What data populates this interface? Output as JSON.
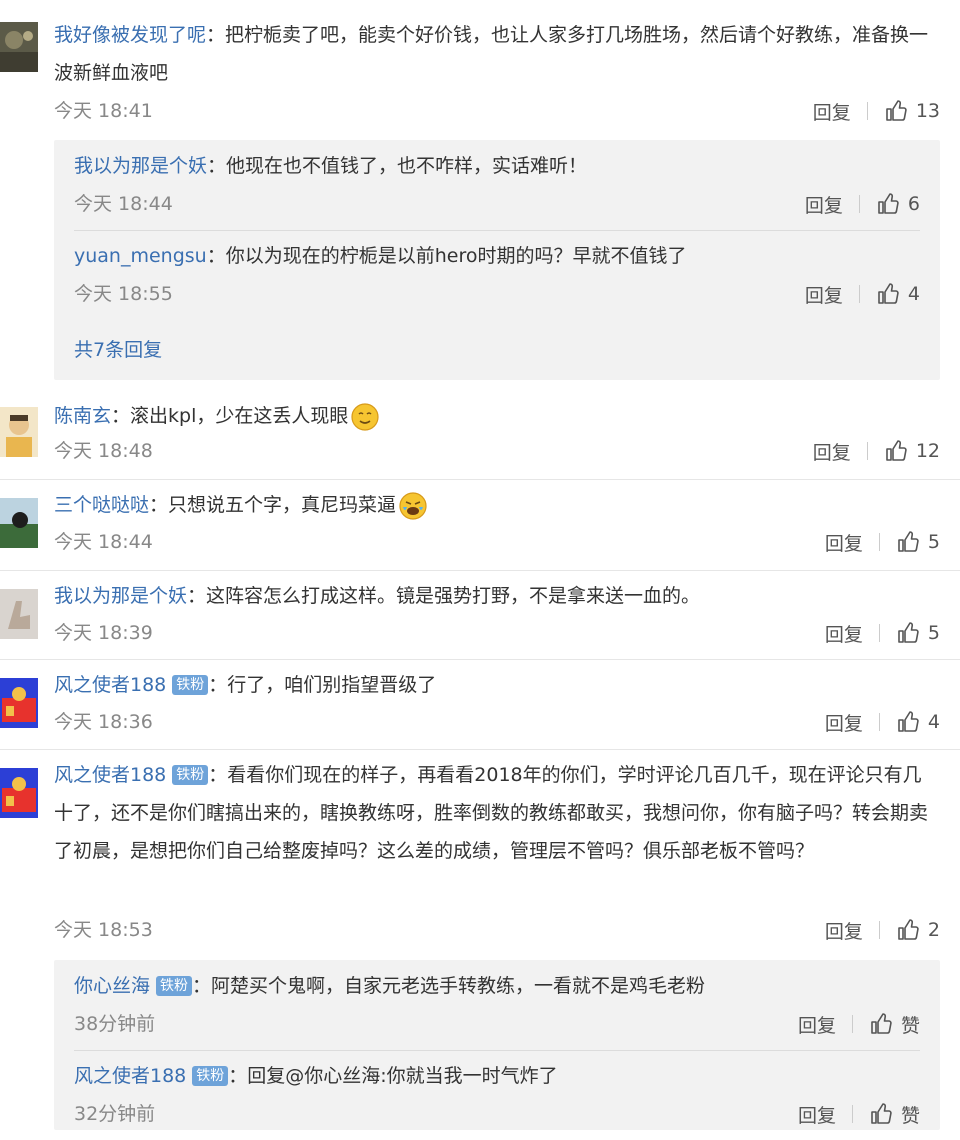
{
  "comments": [
    {
      "user": "我好像被发现了呢",
      "text": "把柠栀卖了吧，能卖个好价钱，也让人家多打几场胜场，然后请个好教练，准备换一波新鲜血液吧",
      "time": "今天 18:41",
      "reply_label": "回复",
      "likes": "13",
      "replies": [
        {
          "user": "我以为那是个妖",
          "text": "他现在也不值钱了，也不咋样，实话难听！",
          "time": "今天 18:44",
          "reply_label": "回复",
          "likes": "6"
        },
        {
          "user": "yuan_mengsu",
          "text": "你以为现在的柠栀是以前hero时期的吗？早就不值钱了",
          "time": "今天 18:55",
          "reply_label": "回复",
          "likes": "4"
        }
      ],
      "more_replies": "共7条回复"
    },
    {
      "user": "陈南玄",
      "text": "滚出kpl，少在这丢人现眼",
      "time": "今天 18:48",
      "reply_label": "回复",
      "likes": "12"
    },
    {
      "user": "三个哒哒哒",
      "text": "只想说五个字，真尼玛菜逼",
      "time": "今天 18:44",
      "reply_label": "回复",
      "likes": "5"
    },
    {
      "user": "我以为那是个妖",
      "text": "这阵容怎么打成这样。镜是强势打野，不是拿来送一血的。",
      "time": "今天 18:39",
      "reply_label": "回复",
      "likes": "5"
    },
    {
      "user": "风之使者188",
      "badge": "铁粉",
      "text": "行了，咱们别指望晋级了",
      "time": "今天 18:36",
      "reply_label": "回复",
      "likes": "4"
    },
    {
      "user": "风之使者188",
      "badge": "铁粉",
      "text": "看看你们现在的样子，再看看2018年的你们，学时评论几百几千，现在评论只有几十了，还不是你们瞎搞出来的，瞎换教练呀，胜率倒数的教练都敢买，我想问你，你有脑子吗？转会期卖了初晨，是想把你们自己给整废掉吗？这么差的成绩，管理层不管吗？俱乐部老板不管吗？",
      "time": "今天 18:53",
      "reply_label": "回复",
      "likes": "2",
      "replies": [
        {
          "user": "你心丝海",
          "badge": "铁粉",
          "text": "阿楚买个鬼啊，自家元老选手转教练，一看就不是鸡毛老粉",
          "time": "38分钟前",
          "reply_label": "回复",
          "likes": "赞"
        },
        {
          "user": "风之使者188",
          "badge": "铁粉",
          "text": "回复@你心丝海:你就当我一时气炸了",
          "time": "32分钟前",
          "reply_label": "回复",
          "likes": "赞"
        }
      ]
    }
  ],
  "colors": {
    "username": "#3a6fb1",
    "badge": "#6ea3d9",
    "reply_bg": "#f2f2f2"
  }
}
